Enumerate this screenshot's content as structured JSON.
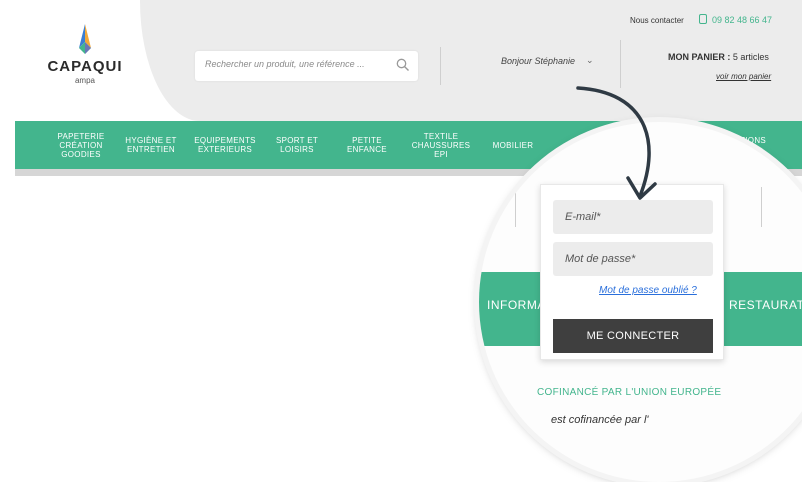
{
  "logo": {
    "name": "CAPAQUI",
    "sub": "ampa"
  },
  "search": {
    "placeholder": "Rechercher un produit, une référence ..."
  },
  "user": {
    "greeting": "Bonjour Stéphanie",
    "chevron": "⌄"
  },
  "contact": {
    "label": "Nous contacter",
    "phone": "09 82 48 66 47"
  },
  "cart": {
    "label": "MON PANIER :",
    "count": "5 articles",
    "link": "voir mon panier"
  },
  "nav": {
    "items": [
      "PAPETERIE\nCRÉATION\nGOODIES",
      "HYGIÈNE ET\nENTRETIEN",
      "EQUIPEMENTS\nEXTERIEURS",
      "SPORT ET\nLOISIRS",
      "PETITE\nENFANCE",
      "TEXTILE\nCHAUSSURES\nEPI",
      "MOBILIER",
      "OTATIONS\nÉES"
    ]
  },
  "login": {
    "email_placeholder": "E-mail*",
    "password_placeholder": "Mot de passe*",
    "forgot_link": "Mot de passe oublié ?",
    "submit": "ME CONNECTER"
  },
  "zoom": {
    "info_text": "INFORMA",
    "resto_text": "RESTAURAT",
    "cofinance": "COFINANCÉ PAR L'UNION EUROPÉE",
    "partial_text": "est cofinancée par l'"
  },
  "colors": {
    "accent_green": "#43b58d",
    "button_dark": "#3f3f3f",
    "link_blue": "#2a6fdb"
  }
}
